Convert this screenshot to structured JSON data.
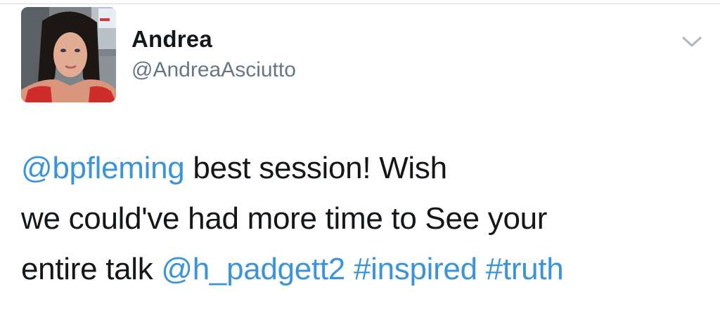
{
  "tweet": {
    "user": {
      "display_name": "Andrea",
      "handle": "@AndreaAsciutto",
      "avatar_icon": "profile-photo"
    },
    "menu_icon": "chevron-down-icon",
    "body_lines": [
      [
        {
          "text": "@bpfleming",
          "kind": "mention"
        },
        {
          "text": " best session! Wish",
          "kind": "text"
        }
      ],
      [
        {
          "text": "we could've had more time to See your",
          "kind": "text"
        }
      ],
      [
        {
          "text": "entire talk ",
          "kind": "text"
        },
        {
          "text": "@h_padgett2",
          "kind": "mention"
        },
        {
          "text": " ",
          "kind": "text"
        },
        {
          "text": "#inspired",
          "kind": "hashtag"
        },
        {
          "text": " ",
          "kind": "text"
        },
        {
          "text": "#truth",
          "kind": "hashtag"
        }
      ]
    ]
  },
  "colors": {
    "text": "#14171a",
    "secondary": "#657786",
    "link": "#3b94d9",
    "background": "#ffffff",
    "divider": "#d9d9d9"
  }
}
